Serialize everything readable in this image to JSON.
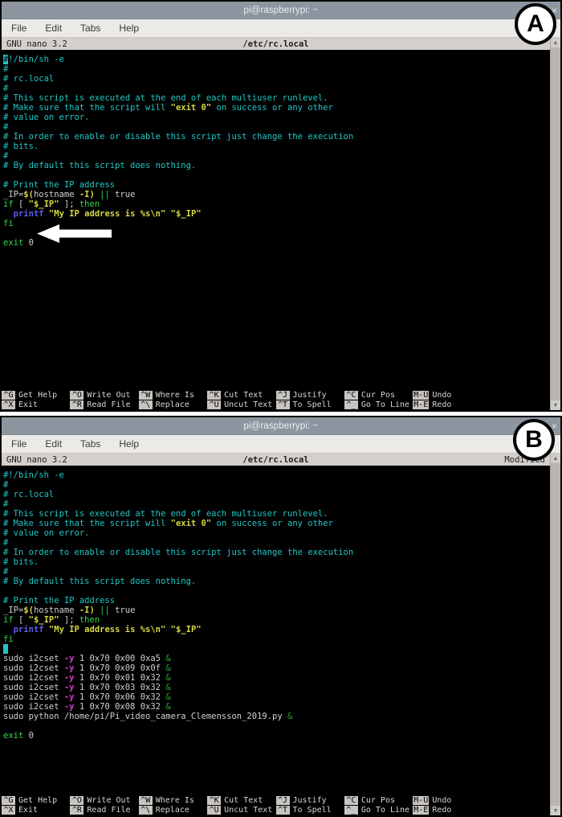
{
  "window": {
    "title": "pi@raspberrypi: ~",
    "controls": [
      {
        "name": "minimize",
        "glyph": "˅"
      },
      {
        "name": "close",
        "glyph": "×"
      }
    ],
    "menu": [
      "File",
      "Edit",
      "Tabs",
      "Help"
    ]
  },
  "nano": {
    "version": "GNU nano 3.2",
    "filename": "/etc/rc.local",
    "modified_flag": "Modified",
    "shortcuts": [
      {
        "key": "^G",
        "label": "Get Help",
        "key2": "^X",
        "label2": "Exit"
      },
      {
        "key": "^O",
        "label": "Write Out",
        "key2": "^R",
        "label2": "Read File"
      },
      {
        "key": "^W",
        "label": "Where Is",
        "key2": "^\\",
        "label2": "Replace"
      },
      {
        "key": "^K",
        "label": "Cut Text",
        "key2": "^U",
        "label2": "Uncut Text"
      },
      {
        "key": "^J",
        "label": "Justify",
        "key2": "^T",
        "label2": "To Spell"
      },
      {
        "key": "^C",
        "label": "Cur Pos",
        "key2": "^_",
        "label2": "Go To Line"
      },
      {
        "key": "M-U",
        "label": "Undo",
        "key2": "M-E",
        "label2": "Redo"
      }
    ]
  },
  "panels": [
    {
      "badge": "A",
      "has_modified_flag": false,
      "has_arrow_annotation": true,
      "has_cursor_block": false,
      "lines": [
        [
          {
            "t": "#",
            "c": "rev"
          },
          {
            "t": "!/bin/sh -e",
            "c": "comment"
          }
        ],
        [
          {
            "t": "#",
            "c": "comment"
          }
        ],
        [
          {
            "t": "# rc.local",
            "c": "comment"
          }
        ],
        [
          {
            "t": "#",
            "c": "comment"
          }
        ],
        [
          {
            "t": "# This script is executed at the end of each multiuser runlevel.",
            "c": "comment"
          }
        ],
        [
          {
            "t": "# Make sure that the script will ",
            "c": "comment"
          },
          {
            "t": "\"exit 0\"",
            "c": "str"
          },
          {
            "t": " on success or any other",
            "c": "comment"
          }
        ],
        [
          {
            "t": "# value on error.",
            "c": "comment"
          }
        ],
        [
          {
            "t": "#",
            "c": "comment"
          }
        ],
        [
          {
            "t": "# In order to enable or disable this script just change the execution",
            "c": "comment"
          }
        ],
        [
          {
            "t": "# bits.",
            "c": "comment"
          }
        ],
        [
          {
            "t": "#",
            "c": "comment"
          }
        ],
        [
          {
            "t": "# By default this script does nothing.",
            "c": "comment"
          }
        ],
        [
          {
            "t": "",
            "c": "plain"
          }
        ],
        [
          {
            "t": "# Print the IP address",
            "c": "comment"
          }
        ],
        [
          {
            "t": "_IP=",
            "c": "plain"
          },
          {
            "t": "$(",
            "c": "str"
          },
          {
            "t": "hostname ",
            "c": "plain"
          },
          {
            "t": "-I",
            "c": "str"
          },
          {
            "t": ")",
            "c": "str"
          },
          {
            "t": " ",
            "c": "plain"
          },
          {
            "t": "||",
            "c": "kw"
          },
          {
            "t": " true",
            "c": "plain"
          }
        ],
        [
          {
            "t": "if",
            "c": "kw"
          },
          {
            "t": " [ ",
            "c": "plain"
          },
          {
            "t": "\"$_IP\"",
            "c": "str"
          },
          {
            "t": " ]; ",
            "c": "plain"
          },
          {
            "t": "then",
            "c": "kw"
          }
        ],
        [
          {
            "t": "  ",
            "c": "plain"
          },
          {
            "t": "printf",
            "c": "fn"
          },
          {
            "t": " ",
            "c": "plain"
          },
          {
            "t": "\"My IP address is %s\\n\"",
            "c": "str"
          },
          {
            "t": " ",
            "c": "plain"
          },
          {
            "t": "\"$_IP\"",
            "c": "str"
          }
        ],
        [
          {
            "t": "fi",
            "c": "kw"
          }
        ],
        [
          {
            "t": "",
            "c": "plain"
          }
        ],
        [
          {
            "t": "exit",
            "c": "kw"
          },
          {
            "t": " 0",
            "c": "plain"
          }
        ]
      ]
    },
    {
      "badge": "B",
      "has_modified_flag": true,
      "has_arrow_annotation": false,
      "has_cursor_block": true,
      "lines": [
        [
          {
            "t": "#!/bin/sh -e",
            "c": "comment"
          }
        ],
        [
          {
            "t": "#",
            "c": "comment"
          }
        ],
        [
          {
            "t": "# rc.local",
            "c": "comment"
          }
        ],
        [
          {
            "t": "#",
            "c": "comment"
          }
        ],
        [
          {
            "t": "# This script is executed at the end of each multiuser runlevel.",
            "c": "comment"
          }
        ],
        [
          {
            "t": "# Make sure that the script will ",
            "c": "comment"
          },
          {
            "t": "\"exit 0\"",
            "c": "str"
          },
          {
            "t": " on success or any other",
            "c": "comment"
          }
        ],
        [
          {
            "t": "# value on error.",
            "c": "comment"
          }
        ],
        [
          {
            "t": "#",
            "c": "comment"
          }
        ],
        [
          {
            "t": "# In order to enable or disable this script just change the execution",
            "c": "comment"
          }
        ],
        [
          {
            "t": "# bits.",
            "c": "comment"
          }
        ],
        [
          {
            "t": "#",
            "c": "comment"
          }
        ],
        [
          {
            "t": "# By default this script does nothing.",
            "c": "comment"
          }
        ],
        [
          {
            "t": "",
            "c": "plain"
          }
        ],
        [
          {
            "t": "# Print the IP address",
            "c": "comment"
          }
        ],
        [
          {
            "t": "_IP=",
            "c": "plain"
          },
          {
            "t": "$(",
            "c": "str"
          },
          {
            "t": "hostname ",
            "c": "plain"
          },
          {
            "t": "-I",
            "c": "str"
          },
          {
            "t": ")",
            "c": "str"
          },
          {
            "t": " ",
            "c": "plain"
          },
          {
            "t": "||",
            "c": "kw"
          },
          {
            "t": " true",
            "c": "plain"
          }
        ],
        [
          {
            "t": "if",
            "c": "kw"
          },
          {
            "t": " [ ",
            "c": "plain"
          },
          {
            "t": "\"$_IP\"",
            "c": "str"
          },
          {
            "t": " ]; ",
            "c": "plain"
          },
          {
            "t": "then",
            "c": "kw"
          }
        ],
        [
          {
            "t": "  ",
            "c": "plain"
          },
          {
            "t": "printf",
            "c": "fn"
          },
          {
            "t": " ",
            "c": "plain"
          },
          {
            "t": "\"My IP address is %s\\n\"",
            "c": "str"
          },
          {
            "t": " ",
            "c": "plain"
          },
          {
            "t": "\"$_IP\"",
            "c": "str"
          }
        ],
        [
          {
            "t": "fi",
            "c": "kw"
          }
        ],
        [
          {
            "t": " ",
            "c": "cursor"
          }
        ],
        [
          {
            "t": "sudo i2cset ",
            "c": "plain"
          },
          {
            "t": "-y",
            "c": "flag"
          },
          {
            "t": " 1 0x70 0x00 0xa5 ",
            "c": "plain"
          },
          {
            "t": "&",
            "c": "amp"
          }
        ],
        [
          {
            "t": "sudo i2cset ",
            "c": "plain"
          },
          {
            "t": "-y",
            "c": "flag"
          },
          {
            "t": " 1 0x70 0x09 0x0f ",
            "c": "plain"
          },
          {
            "t": "&",
            "c": "amp"
          }
        ],
        [
          {
            "t": "sudo i2cset ",
            "c": "plain"
          },
          {
            "t": "-y",
            "c": "flag"
          },
          {
            "t": " 1 0x70 0x01 0x32 ",
            "c": "plain"
          },
          {
            "t": "&",
            "c": "amp"
          }
        ],
        [
          {
            "t": "sudo i2cset ",
            "c": "plain"
          },
          {
            "t": "-y",
            "c": "flag"
          },
          {
            "t": " 1 0x70 0x03 0x32 ",
            "c": "plain"
          },
          {
            "t": "&",
            "c": "amp"
          }
        ],
        [
          {
            "t": "sudo i2cset ",
            "c": "plain"
          },
          {
            "t": "-y",
            "c": "flag"
          },
          {
            "t": " 1 0x70 0x06 0x32 ",
            "c": "plain"
          },
          {
            "t": "&",
            "c": "amp"
          }
        ],
        [
          {
            "t": "sudo i2cset ",
            "c": "plain"
          },
          {
            "t": "-y",
            "c": "flag"
          },
          {
            "t": " 1 0x70 0x08 0x32 ",
            "c": "plain"
          },
          {
            "t": "&",
            "c": "amp"
          }
        ],
        [
          {
            "t": "sudo python /home/pi/Pi_video_camera_Clemensson_2019.py ",
            "c": "plain"
          },
          {
            "t": "&",
            "c": "amp"
          }
        ],
        [
          {
            "t": "",
            "c": "plain"
          }
        ],
        [
          {
            "t": "exit",
            "c": "kw"
          },
          {
            "t": " 0",
            "c": "plain"
          }
        ]
      ]
    }
  ],
  "colors": {
    "titlebar": "#8d96a0",
    "menubar": "#eceae7",
    "terminal_bg": "#000000",
    "nano_status_bg": "#d3d0cb",
    "comment": "#21c7c7",
    "keyword": "#2fd84f",
    "string": "#d8d84a",
    "function": "#5c5cf0",
    "flag": "#cc3fcc",
    "ampersand": "#2fa02f"
  }
}
